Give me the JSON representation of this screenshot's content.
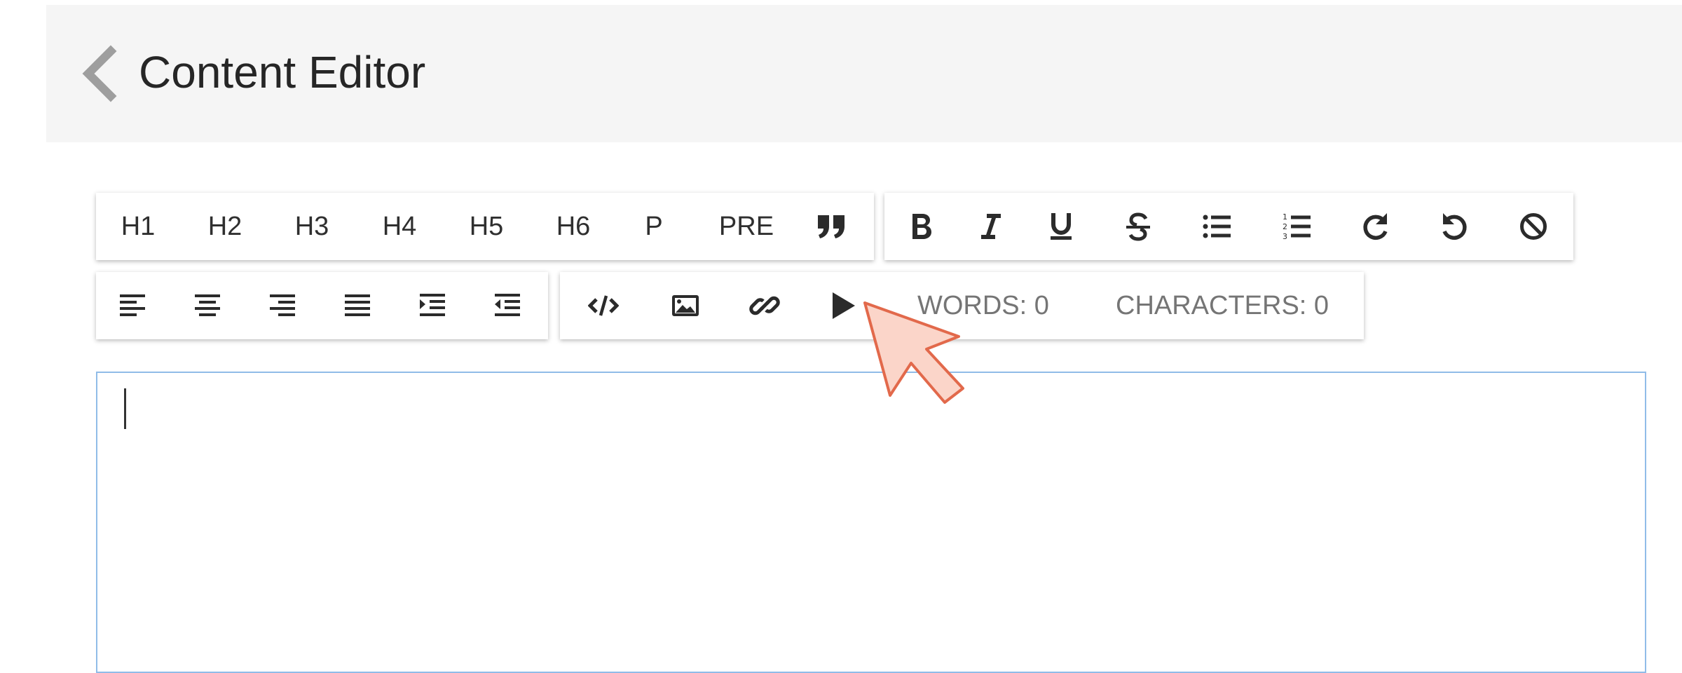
{
  "header": {
    "title": "Content Editor",
    "back_icon": "chevron-left-icon"
  },
  "toolbar_row1": {
    "blocks": [
      "H1",
      "H2",
      "H3",
      "H4",
      "H5",
      "H6",
      "P",
      "PRE"
    ],
    "quote_icon": "format-quote-icon",
    "format_icons": [
      "bold-icon",
      "italic-icon",
      "underline-icon",
      "strikethrough-icon",
      "bulleted-list-icon",
      "numbered-list-icon",
      "redo-icon",
      "undo-icon",
      "clear-format-icon"
    ]
  },
  "toolbar_row2": {
    "align_icons": [
      "align-left-icon",
      "align-center-icon",
      "align-right-icon",
      "align-justify-icon",
      "indent-increase-icon",
      "indent-decrease-icon"
    ],
    "insert_icons": [
      "code-icon",
      "image-icon",
      "link-icon",
      "video-icon"
    ],
    "words_label": "WORDS: 0",
    "characters_label": "CHARACTERS: 0"
  },
  "editor": {
    "value": ""
  },
  "colors": {
    "appbar_bg": "#f5f5f5",
    "editor_border": "#90bce8",
    "cursor_fill": "#fbd5c9",
    "cursor_stroke": "#e2694b"
  }
}
